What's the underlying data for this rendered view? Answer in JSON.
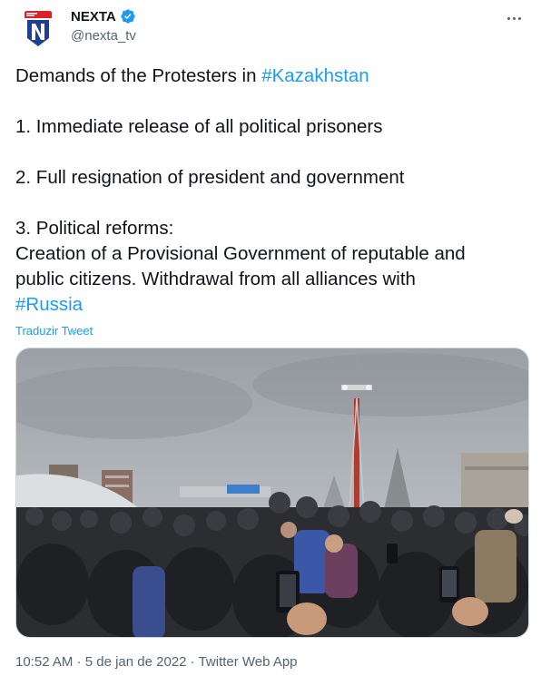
{
  "author": {
    "display_name": "NEXTA",
    "handle": "@nexta_tv",
    "verified": true,
    "avatar_icon": "nexta-logo-icon"
  },
  "tweet": {
    "title_prefix": "Demands of the Protesters in ",
    "title_hashtag": "#Kazakhstan",
    "item1": "1. Immediate release of all political prisoners",
    "item2": "2. Full resignation of president and government",
    "item3_heading": "3. Political reforms:",
    "item3_line1": "Creation of a Provisional Government of reputable and",
    "item3_line2": "public citizens. Withdrawal from all alliances with",
    "item3_hashtag": "#Russia"
  },
  "translate_label": "Traduzir Tweet",
  "meta": {
    "time": "10:52 AM",
    "separator": " · ",
    "date": "5 de jan de 2022",
    "source": "Twitter Web App"
  },
  "colors": {
    "accent": "#1d9bf0",
    "text": "#0f1419",
    "secondary": "#536471",
    "brand_red": "#d8232a",
    "brand_blue": "#1f3f95"
  },
  "icons": {
    "more": "more-horizontal-icon",
    "verified": "verified-badge-icon"
  }
}
